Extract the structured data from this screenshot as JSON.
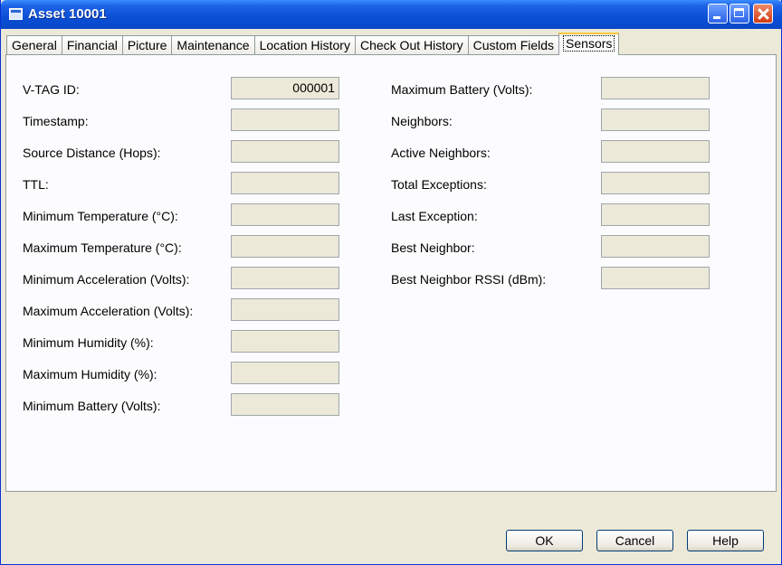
{
  "window": {
    "title": "Asset 10001"
  },
  "tabs": [
    "General",
    "Financial",
    "Picture",
    "Maintenance",
    "Location History",
    "Check Out History",
    "Custom Fields",
    "Sensors"
  ],
  "active_tab": "Sensors",
  "left_fields": [
    {
      "label": "V-TAG ID:",
      "value": "000001"
    },
    {
      "label": "Timestamp:",
      "value": ""
    },
    {
      "label": "Source Distance (Hops):",
      "value": ""
    },
    {
      "label": "TTL:",
      "value": ""
    },
    {
      "label": "Minimum Temperature (°C):",
      "value": ""
    },
    {
      "label": "Maximum Temperature (°C):",
      "value": ""
    },
    {
      "label": "Minimum Acceleration (Volts):",
      "value": ""
    },
    {
      "label": "Maximum Acceleration (Volts):",
      "value": ""
    },
    {
      "label": "Minimum Humidity (%):",
      "value": ""
    },
    {
      "label": "Maximum Humidity (%):",
      "value": ""
    },
    {
      "label": "Minimum Battery (Volts):",
      "value": ""
    }
  ],
  "right_fields": [
    {
      "label": "Maximum Battery (Volts):",
      "value": ""
    },
    {
      "label": "Neighbors:",
      "value": ""
    },
    {
      "label": "Active Neighbors:",
      "value": ""
    },
    {
      "label": "Total Exceptions:",
      "value": ""
    },
    {
      "label": "Last Exception:",
      "value": ""
    },
    {
      "label": "Best Neighbor:",
      "value": ""
    },
    {
      "label": "Best Neighbor RSSI (dBm):",
      "value": ""
    }
  ],
  "buttons": {
    "ok": "OK",
    "cancel": "Cancel",
    "help": "Help"
  }
}
